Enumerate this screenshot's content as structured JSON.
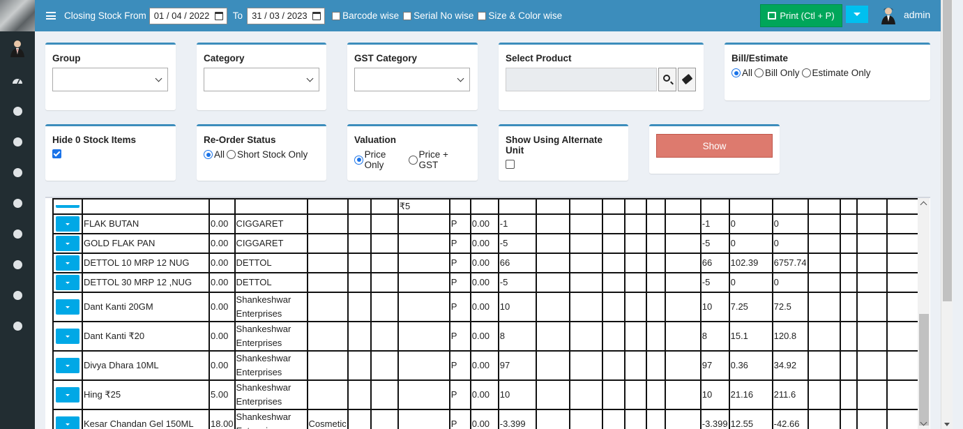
{
  "topbar": {
    "closing_from_label": "Closing Stock From",
    "from_date": "01 / 04 / 2022",
    "to_label": "To",
    "to_date": "31 / 03 / 2023",
    "barcode_label": "Barcode wise",
    "serial_label": "Serial No wise",
    "size_color_label": "Size & Color wise",
    "print_label": "Print (Ctl + P)",
    "user_name": "admin"
  },
  "filters": {
    "group_label": "Group",
    "category_label": "Category",
    "gst_category_label": "GST Category",
    "select_product_label": "Select Product",
    "bill_estimate_label": "Bill/Estimate",
    "bill_options": [
      "All",
      "Bill Only",
      "Estimate Only"
    ],
    "bill_selected": "All",
    "hide_zero_label": "Hide 0 Stock Items",
    "hide_zero_checked": true,
    "reorder_label": "Re-Order Status",
    "reorder_options": [
      "All",
      "Short Stock Only"
    ],
    "reorder_selected": "All",
    "valuation_label": "Valuation",
    "valuation_options": [
      "Price Only",
      "Price + GST"
    ],
    "valuation_selected": "Price Only",
    "alt_unit_label": "Show Using Alternate Unit",
    "alt_unit_checked": false,
    "show_label": "Show"
  },
  "table": {
    "partial_row": {
      "c8": "₹5"
    },
    "rows": [
      {
        "name": "FLAK BUTAN",
        "c3": "0.00",
        "c4": "CIGGARET",
        "c5": "",
        "c10": "P",
        "c11": "0.00",
        "c12": "-1",
        "c18": "-1",
        "c19": "0",
        "c20": "0"
      },
      {
        "name": "GOLD FLAK PAN",
        "c3": "0.00",
        "c4": "CIGGARET",
        "c5": "",
        "c10": "P",
        "c11": "0.00",
        "c12": "-5",
        "c18": "-5",
        "c19": "0",
        "c20": "0"
      },
      {
        "name": "DETTOL 10 MRP 12 NUG",
        "c3": "0.00",
        "c4": "DETTOL",
        "c5": "",
        "c10": "P",
        "c11": "0.00",
        "c12": "66",
        "c18": "66",
        "c19": "102.39",
        "c20": "6757.74"
      },
      {
        "name": "DETTOL 30 MRP 12 ,NUG",
        "c3": "0.00",
        "c4": "DETTOL",
        "c5": "",
        "c10": "P",
        "c11": "0.00",
        "c12": "-5",
        "c18": "-5",
        "c19": "0",
        "c20": "0"
      },
      {
        "name": "Dant Kanti 20GM",
        "c3": "0.00",
        "c4": "Shankeshwar Enterprises",
        "c5": "",
        "c10": "P",
        "c11": "0.00",
        "c12": "10",
        "c18": "10",
        "c19": "7.25",
        "c20": "72.5"
      },
      {
        "name": "Dant Kanti ₹20",
        "c3": "0.00",
        "c4": "Shankeshwar Enterprises",
        "c5": "",
        "c10": "P",
        "c11": "0.00",
        "c12": "8",
        "c18": "8",
        "c19": "15.1",
        "c20": "120.8"
      },
      {
        "name": "Divya Dhara 10ML",
        "c3": "0.00",
        "c4": "Shankeshwar Enterprises",
        "c5": "",
        "c10": "P",
        "c11": "0.00",
        "c12": "97",
        "c18": "97",
        "c19": "0.36",
        "c20": "34.92"
      },
      {
        "name": "Hing ₹25",
        "c3": "5.00",
        "c4": "Shankeshwar Enterprises",
        "c5": "",
        "c10": "P",
        "c11": "0.00",
        "c12": "10",
        "c18": "10",
        "c19": "21.16",
        "c20": "211.6"
      },
      {
        "name": "Kesar Chandan Gel 150ML",
        "c3": "18.00",
        "c4": "Shankeshwar Enterprises",
        "c5": "Cosmetic",
        "c10": "P",
        "c11": "0.00",
        "c12": "-3.399",
        "c18": "-3.399",
        "c19": "12.55",
        "c20": "-42.66"
      }
    ]
  },
  "colors": {
    "header_blue": "#3c8dbc",
    "print_green": "#00a65a",
    "show_red": "#dd7a6e",
    "expand_cyan": "#00a8e6"
  }
}
